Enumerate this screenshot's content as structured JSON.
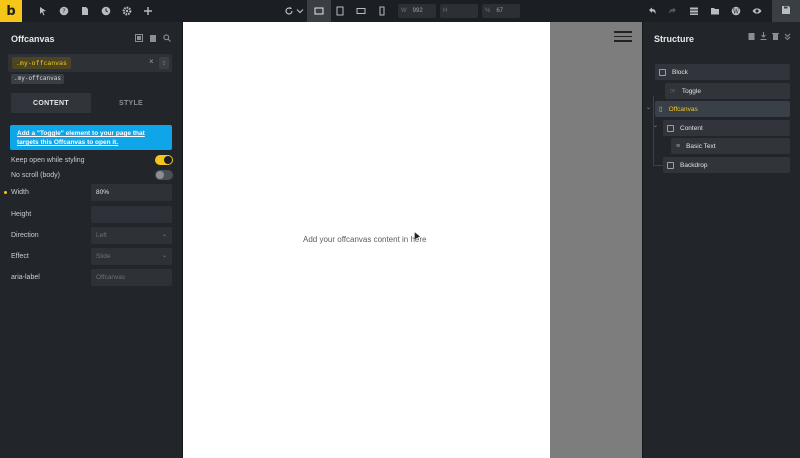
{
  "app": {
    "logo": "b"
  },
  "toolbar": {
    "width_label": "W",
    "width_value": "992",
    "height_label": "H",
    "height_value": "",
    "percent_label": "%",
    "percent_value": "67"
  },
  "left_panel": {
    "title": "Offcanvas",
    "selector": ".my-offcanvas",
    "class_chip": ".my-offcanvas",
    "tabs": [
      {
        "label": "CONTENT"
      },
      {
        "label": "STYLE"
      }
    ],
    "notice": "Add a \"Toggle\" element to your page that targets this Offcanvas to open it.",
    "toggles": [
      {
        "label": "Keep open while styling",
        "state": "on"
      },
      {
        "label": "No scroll (body)",
        "state": "off"
      }
    ],
    "props": [
      {
        "label": "Width",
        "value": "80%"
      },
      {
        "label": "Height",
        "value": ""
      },
      {
        "label": "Direction",
        "value": "Left"
      },
      {
        "label": "Effect",
        "value": "Slide"
      },
      {
        "label": "aria-label",
        "value": "Offcanvas"
      }
    ]
  },
  "canvas": {
    "offcanvas_text": "Add your offcanvas content in here"
  },
  "structure": {
    "title": "Structure",
    "nodes": [
      {
        "label": "Block"
      },
      {
        "label": "Toggle"
      },
      {
        "label": "Offcanvas"
      },
      {
        "label": "Content"
      },
      {
        "label": "Basic Text"
      },
      {
        "label": "Backdrop"
      }
    ]
  },
  "colors": {
    "accent": "#f5c518",
    "notice": "#0ea5e9"
  }
}
